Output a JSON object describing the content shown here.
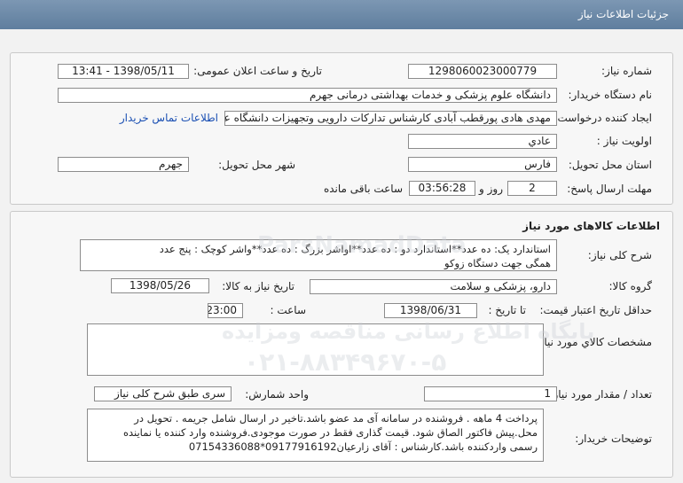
{
  "header": {
    "title": "جزئیات اطلاعات نیاز"
  },
  "info": {
    "need_number_label": "شماره نیاز:",
    "need_number": "1298060023000779",
    "announce_label": "تاریخ و ساعت اعلان عمومی:",
    "announce_value": "1398/05/11 - 13:41",
    "buyer_org_label": "نام دستگاه خریدار:",
    "buyer_org": "دانشگاه علوم پزشکی و خدمات بهداشتی درمانی جهرم",
    "creator_label": "ایجاد کننده درخواست:",
    "creator": "مهدی هادی پورقطب آبادی کارشناس تدارکات دارویی وتجهیزات دانشگاه علوم پز",
    "contact_link": "اطلاعات تماس خریدار",
    "priority_label": "اولویت نیاز :",
    "priority": "عادي",
    "province_label": "استان محل تحویل:",
    "province": "فارس",
    "city_label": "شهر محل تحویل:",
    "city": "جهرم",
    "deadline_label": "مهلت ارسال پاسخ:",
    "deadline_days": "2",
    "deadline_days_unit": "روز و",
    "deadline_time": "03:56:28",
    "deadline_remaining": "ساعت باقی مانده"
  },
  "goods": {
    "section_title": "اطلاعات کالاهای مورد نیاز",
    "desc_label": "شرح کلی نیاز:",
    "desc_line1": "استاندارد یک: ده عدد**استاندارد دو : ده عدد**اواشر بزرگ : ده عدد**واشر کوچک : پنج عدد",
    "desc_line2": "همگی جهت دستگاه زوکو",
    "group_label": "گروه کالا:",
    "group": "دارو، پزشکی و سلامت",
    "need_date_label": "تاریخ نیاز به کالا:",
    "need_date": "1398/05/26",
    "validity_label": "حداقل تاریخ اعتبار قیمت:",
    "until_date_label": "تا تاریخ :",
    "validity_date": "1398/06/31",
    "time_label": "ساعت :",
    "validity_time": "23:00",
    "specs_label": "مشخصات کالاي مورد نیاز:",
    "count_label": "تعداد / مقدار مورد نیاز:",
    "count": "1",
    "unit_label": "واحد شمارش:",
    "unit": "سری طبق شرح کلی نیاز",
    "buyer_notes_label": "توضیحات خریدار:",
    "notes_line1": "پرداخت 4 ماهه . فروشنده در سامانه آی مد عضو باشد.تاخیر در ارسال شامل جریمه  . تحویل در",
    "notes_line2": "محل.پیش فاکتور الصاق شود. قیمت گذاری فقط در صورت موجودی.فروشنده وارد کننده یا نماینده",
    "notes_line3": "رسمی واردکننده باشد.کارشناس : آقای زارعیان09177916192*07154336088"
  },
  "watermark": {
    "site_name": "پایگاه اطلاع رسانی مناقصه ومزایده",
    "phone": "۰۲۱-۸۸۳۴۹۶۷۰-۵",
    "brand": "ParsNamadData"
  }
}
